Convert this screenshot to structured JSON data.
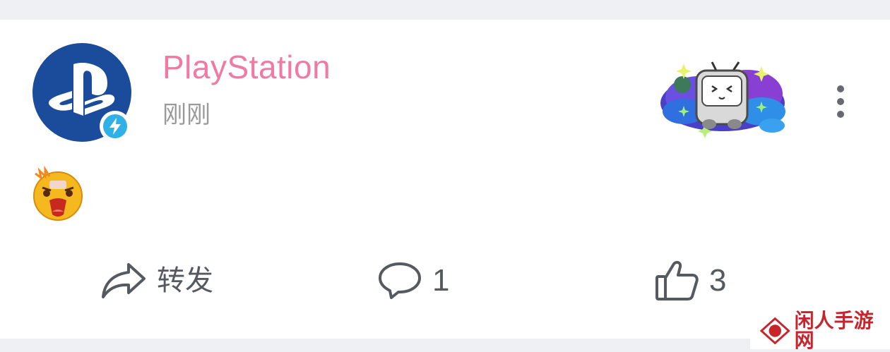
{
  "post": {
    "author": "PlayStation",
    "timestamp": "刚刚",
    "avatar_icon": "playstation-logo",
    "badge_icon": "lightning-bolt-icon",
    "sticker": "bilibili-tv-mascot-sticker",
    "content_emoji": "shocked-angry-face-emoji"
  },
  "actions": {
    "repost_label": "转发",
    "comment_count": "1",
    "like_count": "3"
  },
  "watermark": {
    "text": "闲人手游网"
  },
  "colors": {
    "username": "#f07ba2",
    "avatar_bg": "#1b4b9b",
    "badge": "#2fb1e8",
    "icon_gray": "#555a60",
    "watermark_red": "#c8242c",
    "page_bg": "#eef0f3"
  }
}
